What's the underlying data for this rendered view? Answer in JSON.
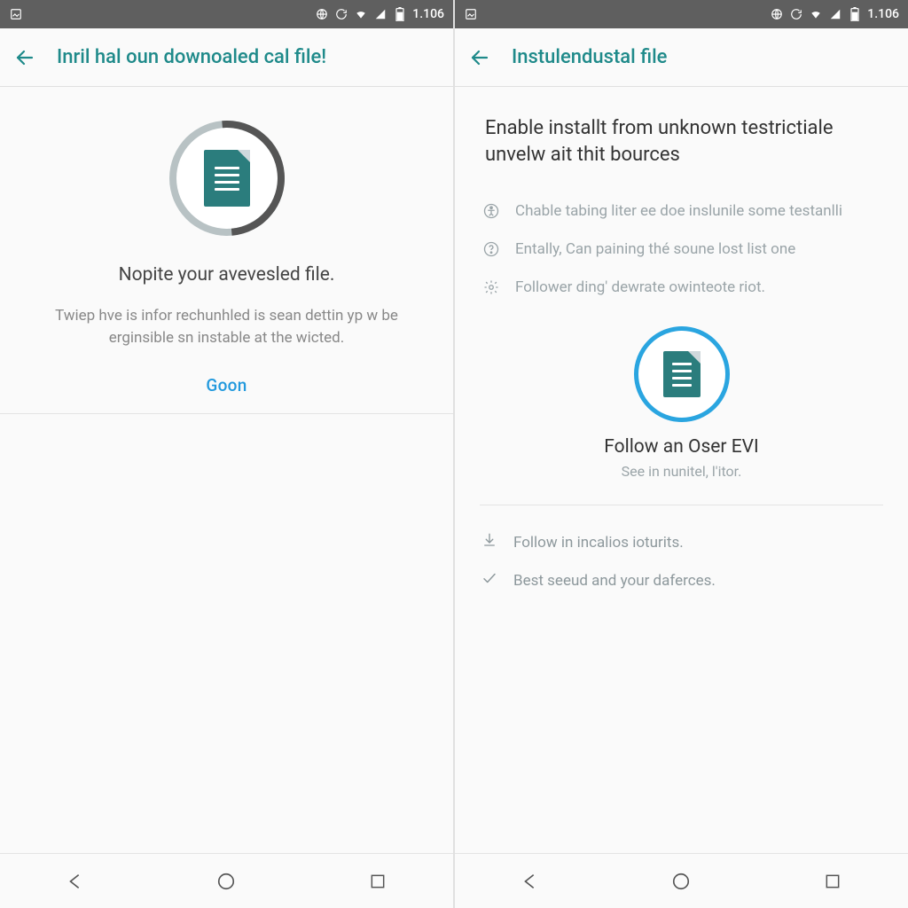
{
  "colors": {
    "accent": "#1f8a8a",
    "link": "#2299dd",
    "ring": "#2aa5e0"
  },
  "status": {
    "time": "1.106",
    "icons": [
      "image-icon",
      "globe-icon",
      "refresh-icon",
      "wifi-icon",
      "signal-icon",
      "battery-icon"
    ]
  },
  "left": {
    "appbar_title": "Inril hal oun downoaled cal file!",
    "hero_title": "Nopite your avevesled file.",
    "hero_sub": "Twiep hve is infor rechunhled is sean dettin yp w be erginsible sn instable at the wicted.",
    "button": "Goon"
  },
  "right": {
    "appbar_title": "Instulendustal file",
    "heading": "Enable installt from unknown testrictiale unvelw ait thit bources",
    "items": [
      "Chable tabing liter ee doe inslunile some testanlli",
      "Entally, Can paining thé soune lost list one",
      "Follower ding' dewrate owinteote riot."
    ],
    "mini_title": "Follow an Oser EVI",
    "mini_sub": "See in nunitel, l'itor.",
    "rows": [
      "Follow in incalios ioturits.",
      "Best seeud and your daferces."
    ]
  },
  "nav": {
    "back": "back",
    "home": "home",
    "recents": "recents"
  }
}
